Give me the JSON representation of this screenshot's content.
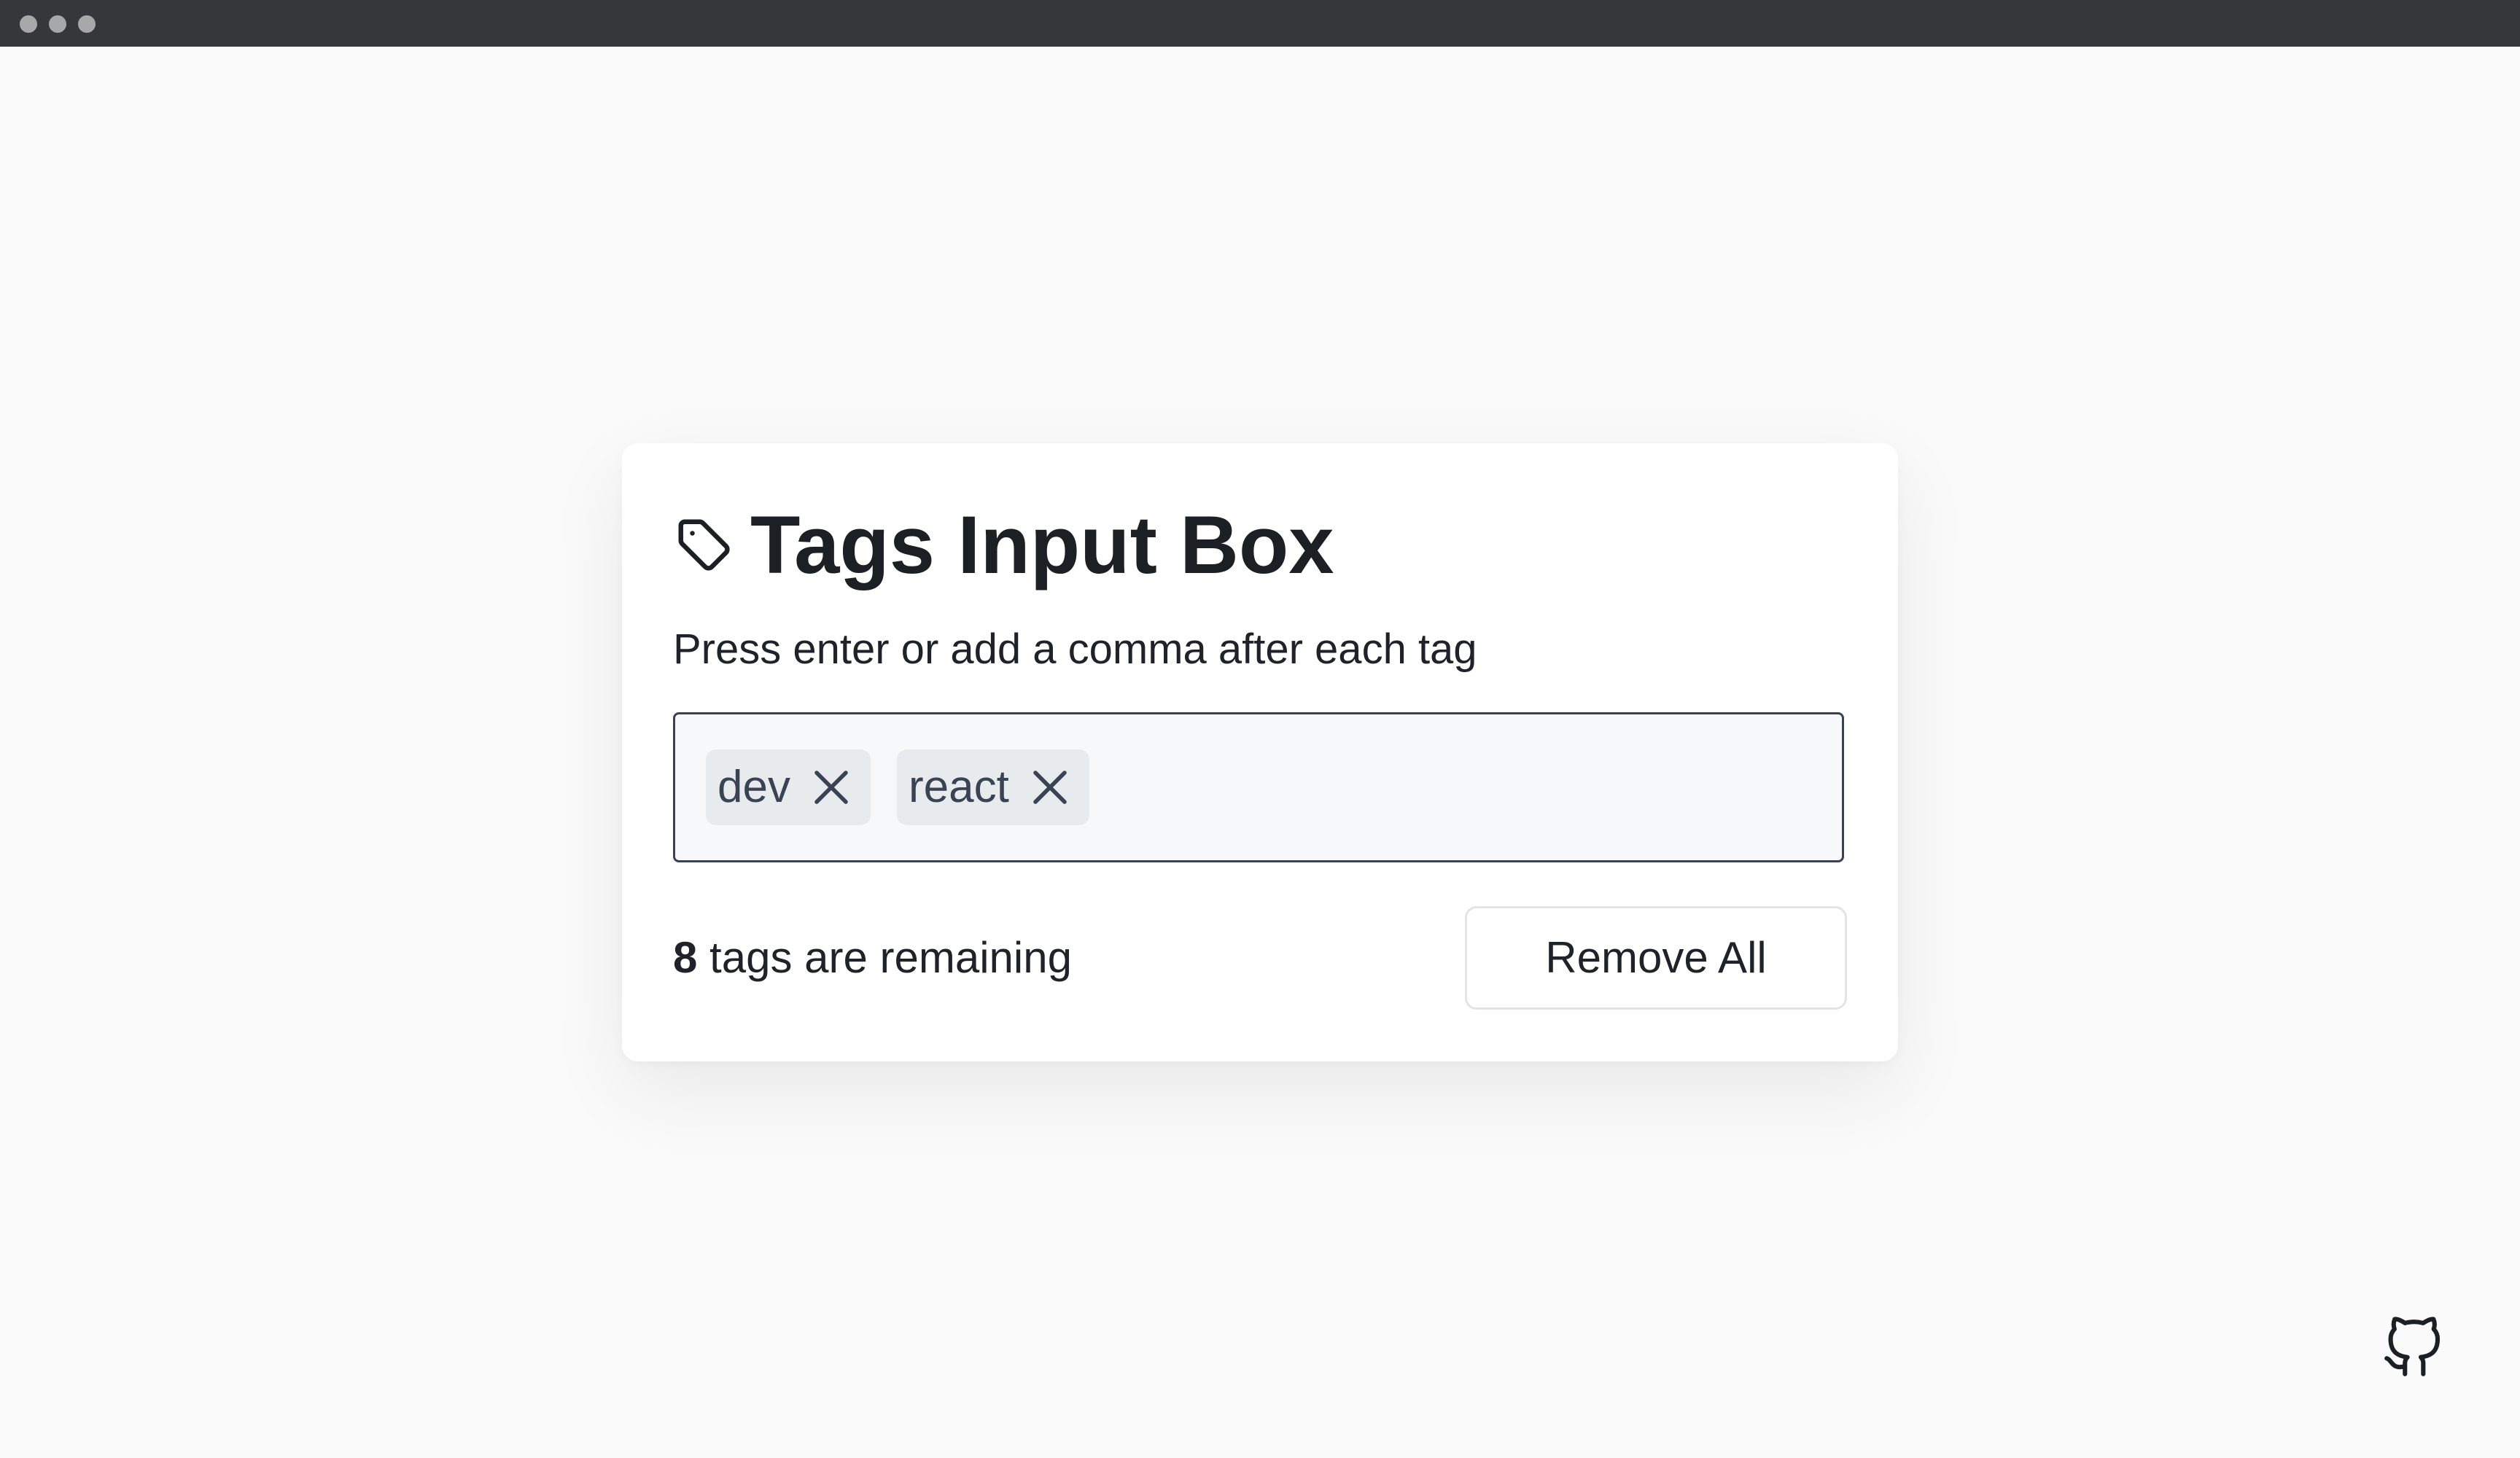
{
  "window": {
    "controls": [
      "close",
      "minimize",
      "maximize"
    ]
  },
  "card": {
    "title_icon": "tag-icon",
    "title": "Tags Input Box",
    "subtitle": "Press enter or add a comma after each tag"
  },
  "tags": [
    {
      "label": "dev",
      "remove_icon": "close-icon"
    },
    {
      "label": "react",
      "remove_icon": "close-icon"
    }
  ],
  "input": {
    "value": "",
    "placeholder": ""
  },
  "status": {
    "remaining_count": "8",
    "remaining_text": " tags are remaining"
  },
  "actions": {
    "remove_all_label": "Remove All"
  },
  "footer": {
    "link_icon": "github-icon"
  },
  "colors": {
    "page_background": "#fafafa",
    "titlebar": "#36373a",
    "card_background": "#ffffff",
    "tag_box_background": "#f6f8fa",
    "tag_box_border": "#3a4150",
    "chip_background": "#e8ebee",
    "text_primary": "#1c1f24"
  }
}
